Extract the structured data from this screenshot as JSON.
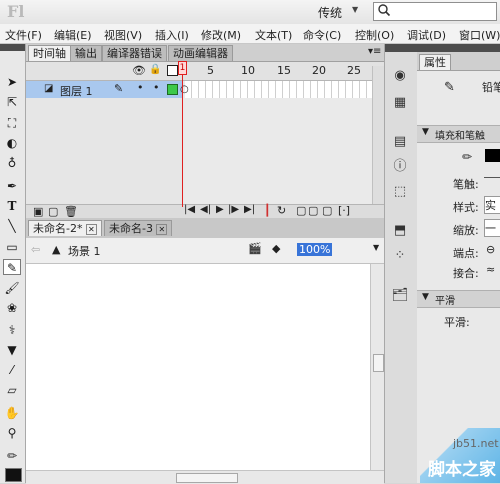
{
  "app": {
    "logo": "Fl",
    "workspace": "传统",
    "search_placeholder": ""
  },
  "menu": [
    {
      "label": "文件(F)"
    },
    {
      "label": "编辑(E)"
    },
    {
      "label": "视图(V)"
    },
    {
      "label": "插入(I)"
    },
    {
      "label": "修改(M)"
    },
    {
      "label": "文本(T)"
    },
    {
      "label": "命令(C)"
    },
    {
      "label": "控制(O)"
    },
    {
      "label": "调试(D)"
    },
    {
      "label": "窗口(W)"
    }
  ],
  "timeline_panel": {
    "tabs": [
      "时间轴",
      "输出",
      "编译器错误",
      "动画编辑器"
    ],
    "frame_ticks": [
      "1",
      "5",
      "10",
      "15",
      "20",
      "25"
    ],
    "layer": {
      "name": "图层 1"
    },
    "current_frame": "1"
  },
  "documents": {
    "tabs": [
      "未命名-2*",
      "未命名-3"
    ],
    "scene": "场景 1",
    "zoom": "100%"
  },
  "properties": {
    "tab": "属性",
    "tool_name": "铅笔",
    "section_fill": "填充和笔触",
    "stroke_label": "笔触:",
    "style_label": "样式:",
    "style_value": "实线",
    "scale_label": "缩放:",
    "scale_value": "一般",
    "cap_label": "端点:",
    "join_label": "接合:",
    "section_smooth": "平滑",
    "smooth_label": "平滑:"
  },
  "watermark": {
    "site": "jb51.net",
    "name": "脚本之家"
  },
  "colors": {
    "layer_highlight": "#a9c8ee",
    "playhead": "#e02020",
    "zoom_highlight": "#3874d8"
  }
}
